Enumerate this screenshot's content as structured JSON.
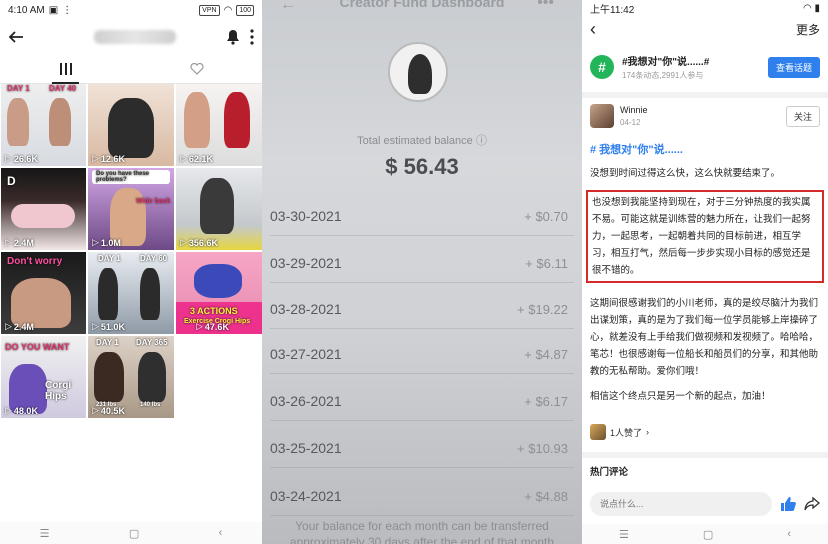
{
  "panel1": {
    "status": {
      "time": "4:10 AM",
      "vpn": "VPN",
      "battery": "100"
    },
    "tabs": [
      {
        "icon": "grid-icon"
      },
      {
        "icon": "liked-icon"
      }
    ],
    "grid": [
      {
        "views": "26.6K",
        "captions": [
          "DAY 1",
          "DAY 40"
        ]
      },
      {
        "views": "12.6K",
        "captions": []
      },
      {
        "views": "62.1K",
        "captions": []
      },
      {
        "views": "2.4M",
        "captions": [
          "D"
        ]
      },
      {
        "views": "1.0M",
        "captions": [
          "Do you have these problems?",
          "Wide back"
        ]
      },
      {
        "views": "356.6K",
        "captions": []
      },
      {
        "views": "2.4M",
        "captions": [
          "Don't worry"
        ]
      },
      {
        "views": "51.0K",
        "captions": [
          "DAY 1",
          "DAY 60"
        ]
      },
      {
        "views": "47.6K",
        "captions": [
          "3 ACTIONS",
          "Exercise Crogi Hips"
        ]
      },
      {
        "views": "48.0K",
        "captions": [
          "DO YOU WANT",
          "Corgi Hips"
        ]
      },
      {
        "views": "40.5K",
        "captions": [
          "DAY 1",
          "DAY 365",
          "231 lbs",
          "140 lbs"
        ]
      }
    ]
  },
  "panel2": {
    "title": "Creator Fund Dashboard",
    "balance_label": "Total estimated balance",
    "balance_value": "$ 56.43",
    "rows": [
      {
        "date": "03-30-2021",
        "amount": "+ $0.70"
      },
      {
        "date": "03-29-2021",
        "amount": "+ $6.11"
      },
      {
        "date": "03-28-2021",
        "amount": "+ $19.22"
      },
      {
        "date": "03-27-2021",
        "amount": "+ $4.87"
      },
      {
        "date": "03-26-2021",
        "amount": "+ $6.17"
      },
      {
        "date": "03-25-2021",
        "amount": "+ $10.93"
      },
      {
        "date": "03-24-2021",
        "amount": "+ $4.88"
      }
    ],
    "footer": "Your balance for each month can be transferred approximately 30 days after the end of that month"
  },
  "panel3": {
    "status": {
      "time": "上午11:42"
    },
    "nav": {
      "more": "更多"
    },
    "topic": {
      "title": "#我想对\"你\"说......#",
      "stats": "174条动态,2991人参与",
      "button": "查看话题"
    },
    "author": {
      "name": "Winnie",
      "date": "04-12",
      "follow": "关注"
    },
    "post": {
      "tag": "# 我想对\"你\"说......",
      "p1": "没想到时间过得这么快，这么快就要结束了。",
      "p2": "也没想到我能坚持到现在，对于三分钟热度的我实属不易。可能这就是训练营的魅力所在，让我们一起努力，一起思考，一起朝着共同的目标前进，相互学习，相互打气，然后每一步步实现小目标的感觉还是很不错的。",
      "p3": "这期间很感谢我们的小川老师，真的是绞尽脑汁为我们出谋划策，真的是为了我们每一位学员能够上岸操碎了心，就差没有上手给我们做视频和发视频了。哈哈哈，笔芯！也很感谢每一位船长和船员们的分享，和其他助教的无私帮助。爱你们哦！",
      "p4": "相信这个终点只是另一个新的起点，加油！"
    },
    "likes": "1人赞了",
    "hot_comments": "热门评论",
    "comment_placeholder": "说点什么..."
  }
}
